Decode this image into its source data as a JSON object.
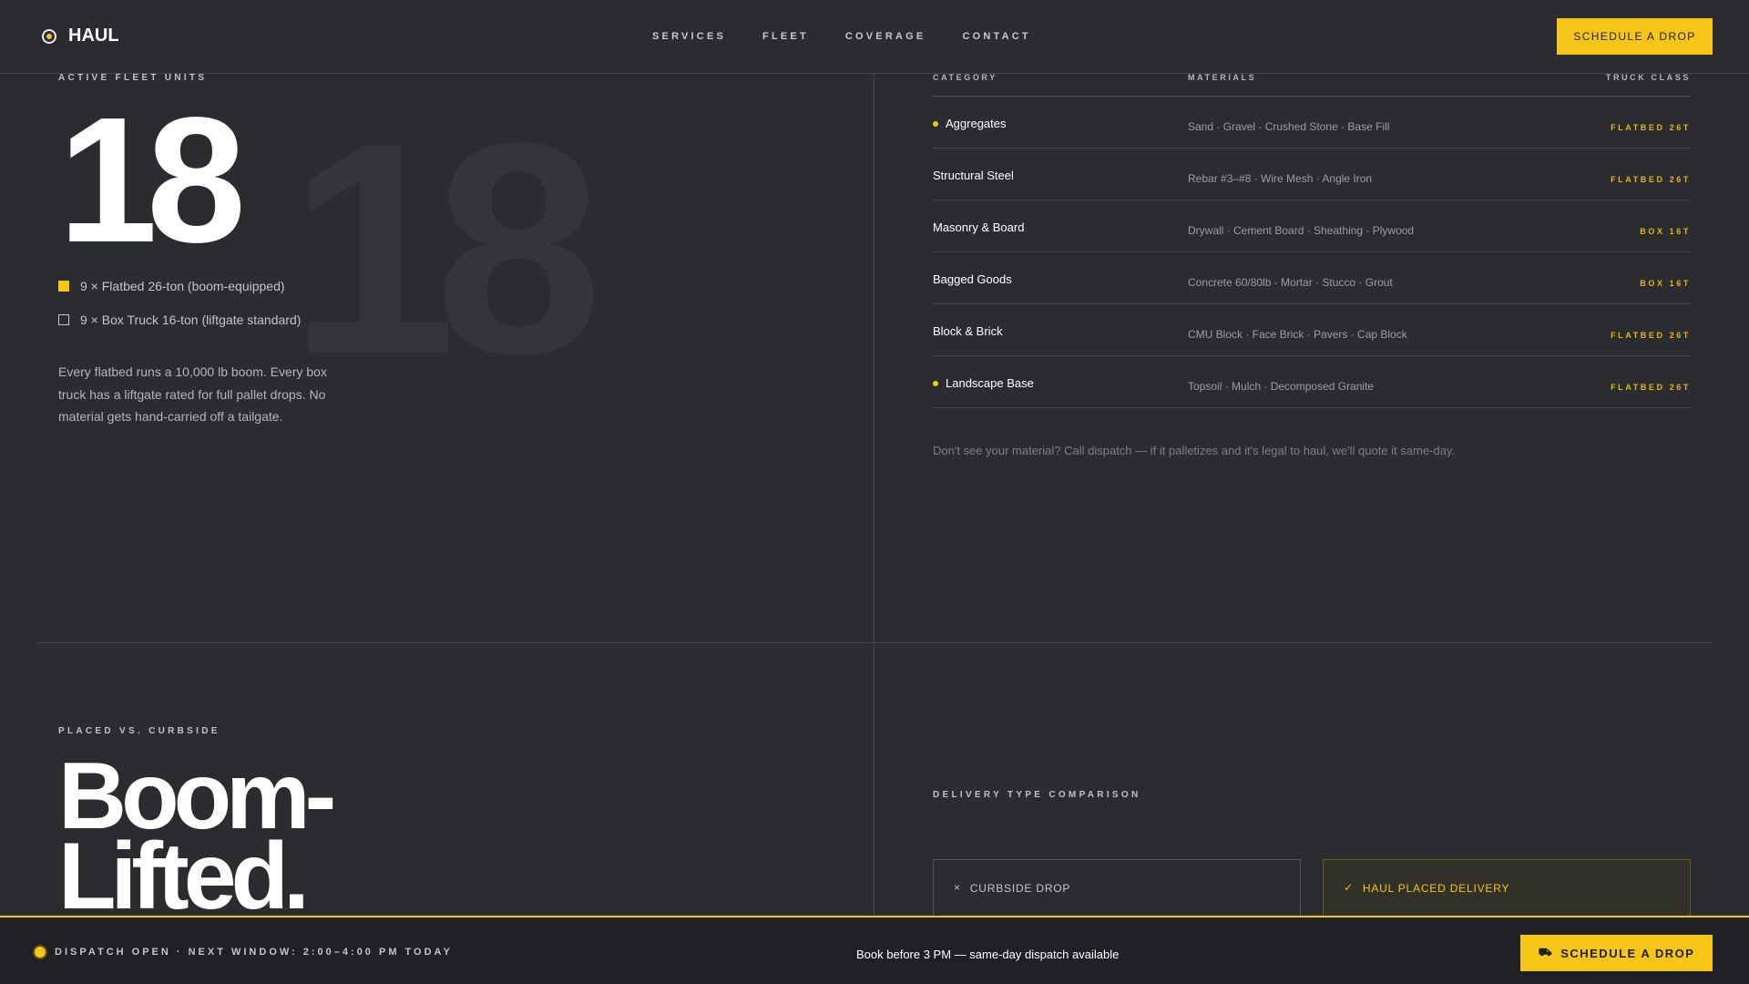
{
  "header": {
    "brand": "HAUL",
    "nav": [
      "SERVICES",
      "FLEET",
      "COVERAGE",
      "CONTACT"
    ],
    "cta": "SCHEDULE A DROP"
  },
  "fleet": {
    "eyebrow": "ACTIVE FLEET UNITS",
    "count": "18",
    "units": [
      {
        "label": "9 × Flatbed 26-ton (boom-equipped)",
        "marker": "filled"
      },
      {
        "label": "9 × Box Truck 16-ton (liftgate standard)",
        "marker": "outline"
      }
    ],
    "description": "Every flatbed runs a 10,000 lb boom. Every box truck has a liftgate rated for full pallet drops. No material gets hand-carried off a tailgate."
  },
  "materials": {
    "headers": {
      "category": "CATEGORY",
      "materials": "MATERIALS",
      "truck_class": "TRUCK CLASS"
    },
    "rows": [
      {
        "category": "Aggregates",
        "materials": "Sand · Gravel · Crushed Stone · Base Fill",
        "truck_class": "FLATBED 26T",
        "highlighted": true
      },
      {
        "category": "Structural Steel",
        "materials": "Rebar #3–#8 · Wire Mesh · Angle Iron",
        "truck_class": "FLATBED 26T",
        "highlighted": false
      },
      {
        "category": "Masonry & Board",
        "materials": "Drywall · Cement Board · Sheathing · Plywood",
        "truck_class": "BOX 16T",
        "highlighted": false
      },
      {
        "category": "Bagged Goods",
        "materials": "Concrete 60/80lb · Mortar · Stucco · Grout",
        "truck_class": "BOX 16T",
        "highlighted": false
      },
      {
        "category": "Block & Brick",
        "materials": "CMU Block · Face Brick · Pavers · Cap Block",
        "truck_class": "FLATBED 26T",
        "highlighted": false
      },
      {
        "category": "Landscape Base",
        "materials": "Topsoil · Mulch · Decomposed Granite",
        "truck_class": "FLATBED 26T",
        "highlighted": true
      }
    ],
    "note": "Don't see your material? Call dispatch — if it palletizes and it's legal to haul, we'll quote it same-day."
  },
  "placed": {
    "eyebrow": "PLACED VS. CURBSIDE",
    "title_line1": "Boom-",
    "title_line2": "Lifted."
  },
  "comparison": {
    "eyebrow": "DELIVERY TYPE COMPARISON",
    "curbside": {
      "label": "CURBSIDE DROP",
      "icon": "×"
    },
    "haul": {
      "label": "HAUL PLACED DELIVERY",
      "icon": "✓"
    }
  },
  "footer": {
    "status": "DISPATCH OPEN · NEXT WINDOW: 2:00–4:00 PM TODAY",
    "message": "Book before 3 PM — same-day dispatch available",
    "cta": "SCHEDULE A DROP"
  },
  "colors": {
    "accent": "#f5c518",
    "background": "#2b2c30",
    "footer": "#1f2024"
  }
}
